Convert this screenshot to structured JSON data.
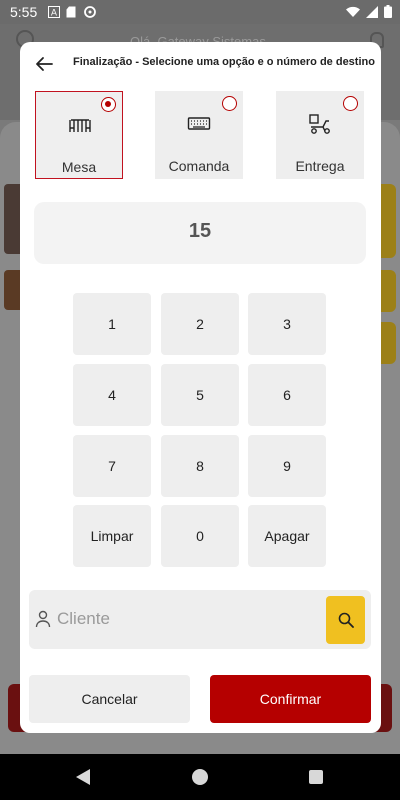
{
  "status_bar": {
    "time": "5:55",
    "icons": [
      "a-icon",
      "sd-card-icon",
      "sync-icon",
      "wifi-icon",
      "signal-icon",
      "battery-icon"
    ]
  },
  "background": {
    "greeting": "Olá, Gateway Sistemas"
  },
  "dialog": {
    "title": "Finalização - Selecione uma opção e o número de destino",
    "options": [
      {
        "label": "Mesa",
        "icon": "table-icon",
        "selected": true
      },
      {
        "label": "Comanda",
        "icon": "keyboard-icon",
        "selected": false
      },
      {
        "label": "Entrega",
        "icon": "delivery-scooter-icon",
        "selected": false
      }
    ],
    "display_value": "15",
    "keypad": {
      "k1": "1",
      "k2": "2",
      "k3": "3",
      "k4": "4",
      "k5": "5",
      "k6": "6",
      "k7": "7",
      "k8": "8",
      "k9": "9",
      "clear": "Limpar",
      "k0": "0",
      "delete": "Apagar"
    },
    "client_search": {
      "placeholder": "Cliente",
      "value": ""
    },
    "cancel_label": "Cancelar",
    "confirm_label": "Confirmar"
  },
  "colors": {
    "accent_red": "#b50000",
    "search_yellow": "#f0c020",
    "key_gray": "#eeeeee"
  }
}
